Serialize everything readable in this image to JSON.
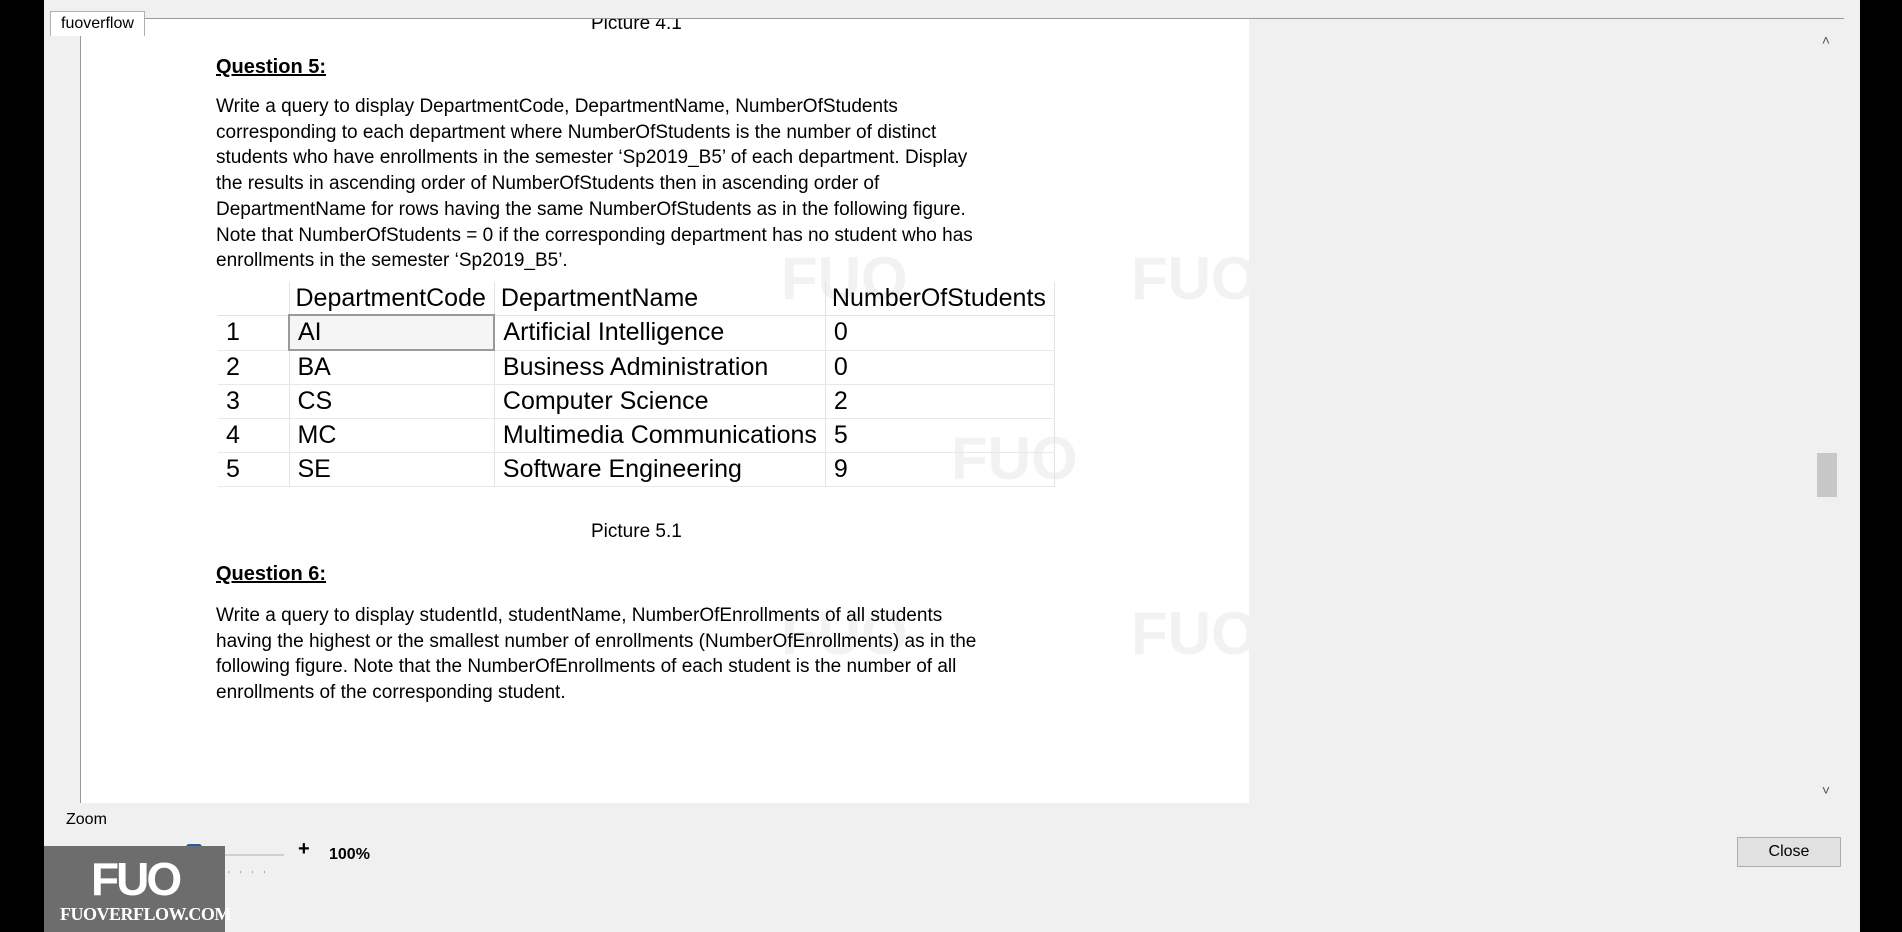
{
  "window": {
    "title": "fuoverflow"
  },
  "document": {
    "cut_caption": "Picture 4.1",
    "question5": {
      "heading": "Question 5:",
      "lines": [
        "Write a query to display DepartmentCode, DepartmentName, NumberOfStudents",
        "corresponding to each department where NumberOfStudents is the number of distinct",
        "students who have enrollments in the semester ‘Sp2019_B5’ of each department. Display",
        "the results in ascending order of NumberOfStudents then in ascending order of",
        "DepartmentName for rows having the same NumberOfStudents as in the following figure.",
        "Note that NumberOfStudents = 0 if the corresponding department has no student who has",
        "enrollments in the semester ‘Sp2019_B5’."
      ]
    },
    "table": {
      "columns": [
        "",
        "DepartmentCode",
        "DepartmentName",
        "NumberOfStudents"
      ],
      "rows": [
        [
          "1",
          "AI",
          "Artificial Intelligence",
          "0"
        ],
        [
          "2",
          "BA",
          "Business Administration",
          "0"
        ],
        [
          "3",
          "CS",
          "Computer Science",
          "2"
        ],
        [
          "4",
          "MC",
          "Multimedia Communications",
          "5"
        ],
        [
          "5",
          "SE",
          "Software Engineering",
          "9"
        ]
      ]
    },
    "caption": "Picture 5.1",
    "question6": {
      "heading": "Question 6:",
      "lines": [
        "Write a query to display studentId, studentName, NumberOfEnrollments of all students",
        "having the highest or the smallest number of enrollments (NumberOfEnrollments) as in the",
        "following figure. Note that the NumberOfEnrollments of each student is the number of all",
        "enrollments of the corresponding student."
      ]
    },
    "watermark": "FUO"
  },
  "zoom": {
    "label": "Zoom",
    "minus": "-",
    "plus": "+",
    "value": "100%",
    "level_percent": 100
  },
  "close_label": "Close",
  "logo": {
    "mark": "FUO",
    "text": "FUOVERFLOW.COM"
  },
  "scroll": {
    "up": "˄",
    "down": "˅"
  }
}
